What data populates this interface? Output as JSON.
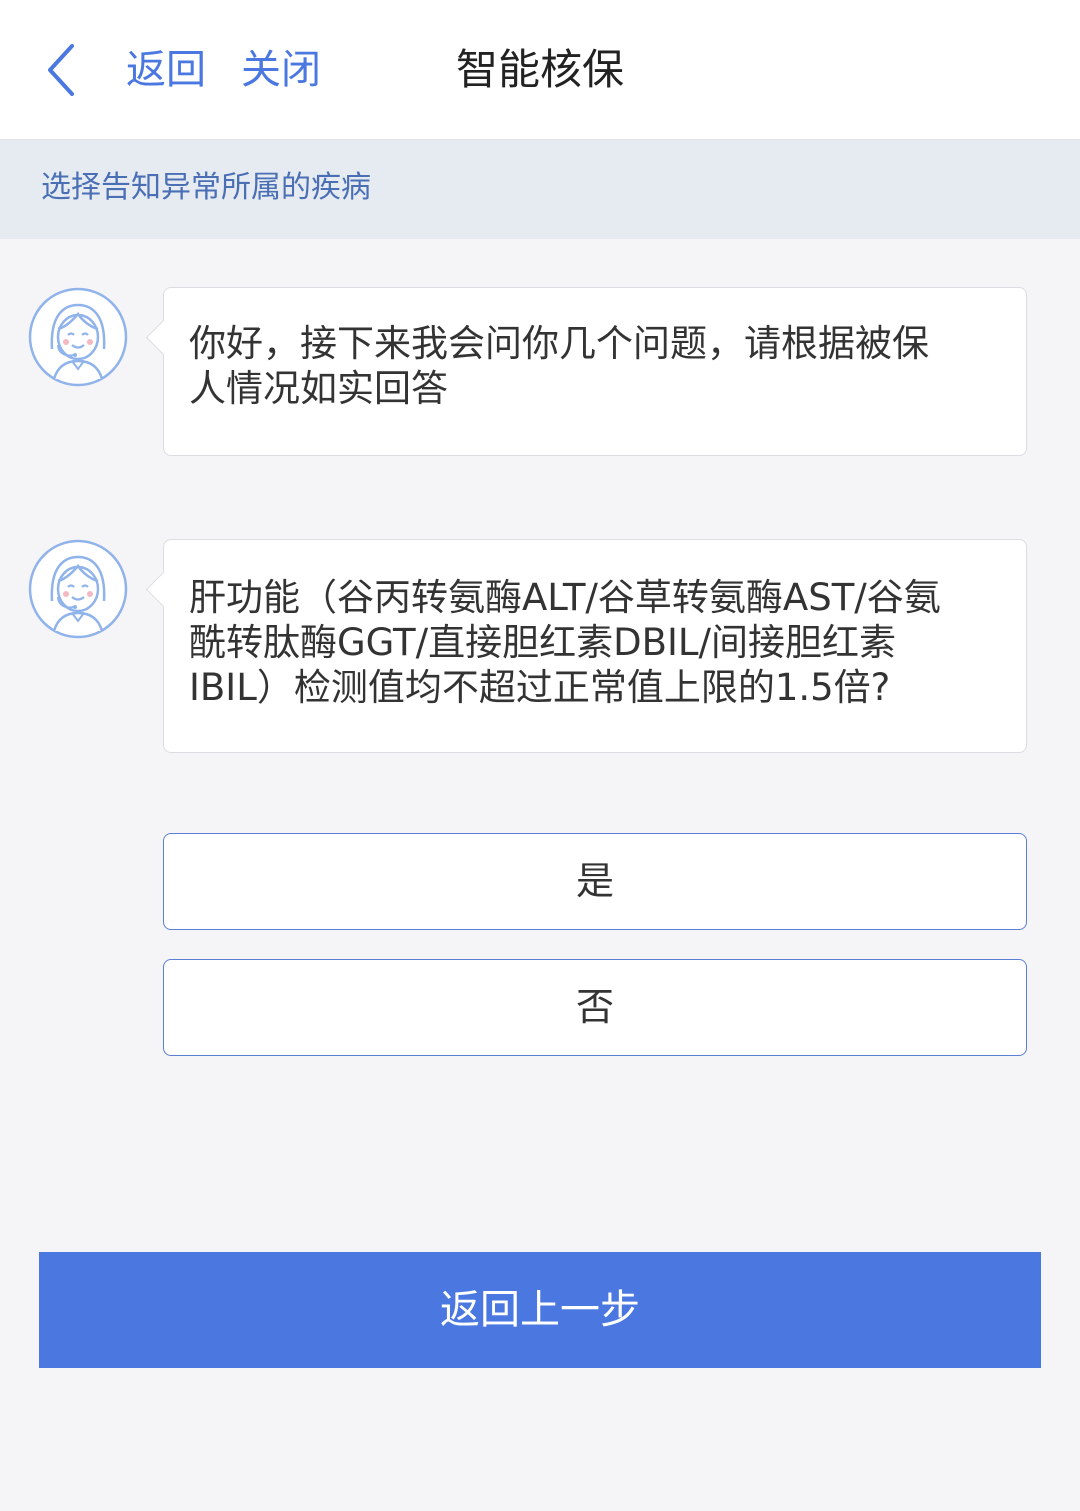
{
  "navbar": {
    "back_label": "返回",
    "close_label": "关闭",
    "title": "智能核保"
  },
  "subheader": {
    "text": "选择告知异常所属的疾病"
  },
  "messages": [
    {
      "text": "你好，接下来我会问你几个问题，请根据被保\n人情况如实回答"
    },
    {
      "text": "肝功能（谷丙转氨酶ALT/谷草转氨酶AST/谷氨\n酰转肽酶GGT/直接胆红素DBIL/间接胆红素\nIBIL）检测值均不超过正常值上限的1.5倍?"
    }
  ],
  "options": [
    {
      "label": "是"
    },
    {
      "label": "否"
    }
  ],
  "footer": {
    "back_step_label": "返回上一步"
  },
  "colors": {
    "accent": "#4a78e0",
    "subheader_bg": "#e6ebf2",
    "page_bg": "#f5f5f7"
  }
}
